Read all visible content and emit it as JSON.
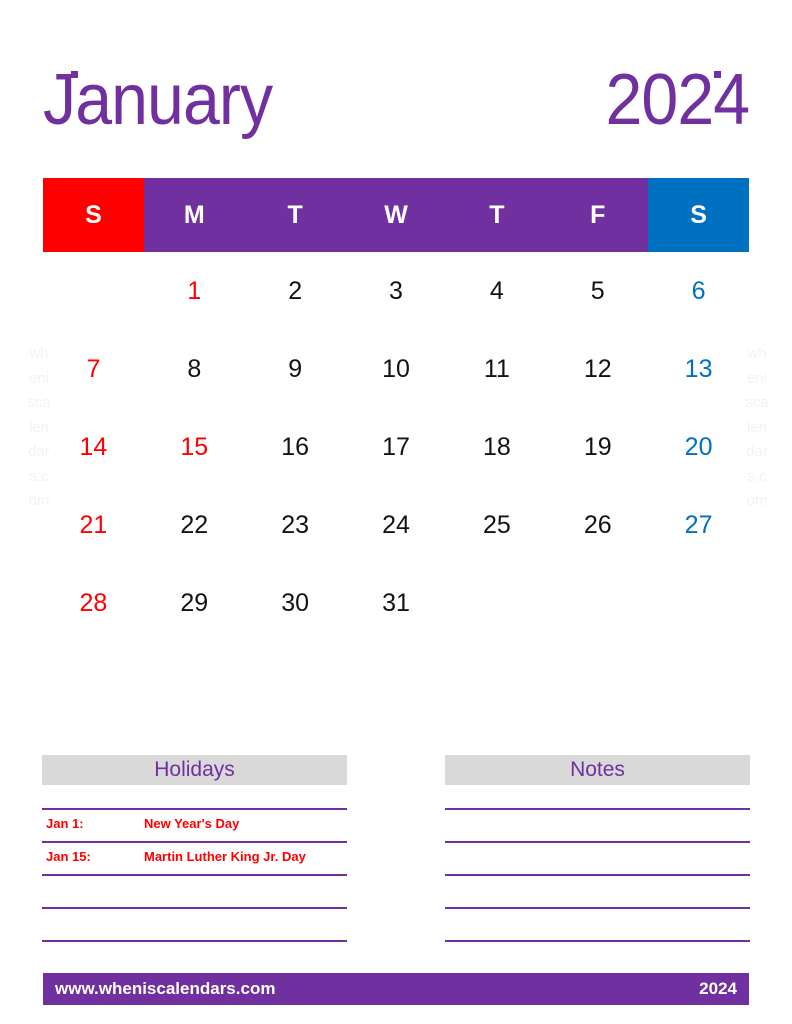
{
  "title": {
    "month": "January",
    "year": "2024",
    "color": "#7030a0"
  },
  "weekdays": [
    {
      "label": "S",
      "kind": "sunday"
    },
    {
      "label": "M",
      "kind": "weekday"
    },
    {
      "label": "T",
      "kind": "weekday"
    },
    {
      "label": "W",
      "kind": "weekday"
    },
    {
      "label": "T",
      "kind": "weekday"
    },
    {
      "label": "F",
      "kind": "weekday"
    },
    {
      "label": "S",
      "kind": "saturday"
    }
  ],
  "colors": {
    "purple": "#7030a0",
    "red": "#ff0000",
    "blue": "#0070c0",
    "gray": "#d9d9d9",
    "black": "#131313",
    "watermark": "#f4f1f6"
  },
  "weeks": [
    [
      {
        "day": "",
        "color": "empty"
      },
      {
        "day": "1",
        "color": "red"
      },
      {
        "day": "2",
        "color": "black"
      },
      {
        "day": "3",
        "color": "black"
      },
      {
        "day": "4",
        "color": "black"
      },
      {
        "day": "5",
        "color": "black"
      },
      {
        "day": "6",
        "color": "blue"
      }
    ],
    [
      {
        "day": "7",
        "color": "red"
      },
      {
        "day": "8",
        "color": "black"
      },
      {
        "day": "9",
        "color": "black"
      },
      {
        "day": "10",
        "color": "black"
      },
      {
        "day": "11",
        "color": "black"
      },
      {
        "day": "12",
        "color": "black"
      },
      {
        "day": "13",
        "color": "blue"
      }
    ],
    [
      {
        "day": "14",
        "color": "red"
      },
      {
        "day": "15",
        "color": "red"
      },
      {
        "day": "16",
        "color": "black"
      },
      {
        "day": "17",
        "color": "black"
      },
      {
        "day": "18",
        "color": "black"
      },
      {
        "day": "19",
        "color": "black"
      },
      {
        "day": "20",
        "color": "blue"
      }
    ],
    [
      {
        "day": "21",
        "color": "red"
      },
      {
        "day": "22",
        "color": "black"
      },
      {
        "day": "23",
        "color": "black"
      },
      {
        "day": "24",
        "color": "black"
      },
      {
        "day": "25",
        "color": "black"
      },
      {
        "day": "26",
        "color": "black"
      },
      {
        "day": "27",
        "color": "blue"
      }
    ],
    [
      {
        "day": "28",
        "color": "red"
      },
      {
        "day": "29",
        "color": "black"
      },
      {
        "day": "30",
        "color": "black"
      },
      {
        "day": "31",
        "color": "black"
      },
      {
        "day": "",
        "color": "empty"
      },
      {
        "day": "",
        "color": "empty"
      },
      {
        "day": "",
        "color": "empty"
      }
    ]
  ],
  "holidays_panel": {
    "heading": "Holidays",
    "rows": [
      {
        "date": "Jan 1:",
        "name": "New Year's Day"
      },
      {
        "date": "Jan 15:",
        "name": "Martin Luther King Jr. Day"
      },
      {
        "date": "",
        "name": ""
      },
      {
        "date": "",
        "name": ""
      }
    ]
  },
  "notes_panel": {
    "heading": "Notes",
    "rows": [
      {
        "text": ""
      },
      {
        "text": ""
      },
      {
        "text": ""
      },
      {
        "text": ""
      }
    ]
  },
  "watermark": {
    "text": "wheniscalendars.com"
  },
  "footer": {
    "url": "www.wheniscalendars.com",
    "year": "2024"
  }
}
